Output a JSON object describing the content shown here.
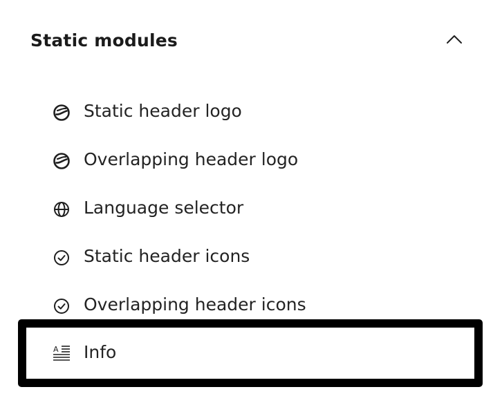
{
  "section": {
    "title": "Static modules",
    "expanded": true
  },
  "items": [
    {
      "label": "Static header logo",
      "icon": "logo-icon"
    },
    {
      "label": "Overlapping header logo",
      "icon": "logo-icon"
    },
    {
      "label": "Language selector",
      "icon": "globe-icon"
    },
    {
      "label": "Static header icons",
      "icon": "check-circle-icon"
    },
    {
      "label": "Overlapping header icons",
      "icon": "check-circle-icon"
    },
    {
      "label": "Info",
      "icon": "text-format-icon",
      "selected": true
    }
  ],
  "colors": {
    "text": "#232323",
    "selection_border": "#000000",
    "background": "#ffffff"
  }
}
